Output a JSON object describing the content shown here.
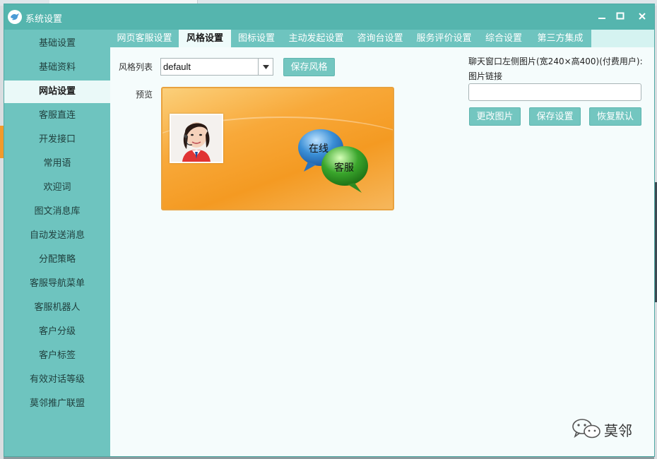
{
  "window": {
    "title": "系统设置",
    "controls": [
      "minimize-icon",
      "maximize-icon",
      "close-icon"
    ]
  },
  "sidebar": {
    "items": [
      {
        "label": "基础设置"
      },
      {
        "label": "基础资料"
      },
      {
        "label": "网站设置",
        "active": true
      },
      {
        "label": "客服直连"
      },
      {
        "label": "开发接口"
      },
      {
        "label": "常用语"
      },
      {
        "label": "欢迎词"
      },
      {
        "label": "图文消息库"
      },
      {
        "label": "自动发送消息"
      },
      {
        "label": "分配策略"
      },
      {
        "label": "客服导航菜单"
      },
      {
        "label": "客服机器人"
      },
      {
        "label": "客户分级"
      },
      {
        "label": "客户标签"
      },
      {
        "label": "有效对话等级"
      },
      {
        "label": "莫邻推广联盟"
      }
    ]
  },
  "tabs": [
    {
      "label": "网页客服设置"
    },
    {
      "label": "风格设置",
      "active": true
    },
    {
      "label": "图标设置"
    },
    {
      "label": "主动发起设置"
    },
    {
      "label": "咨询台设置"
    },
    {
      "label": "服务评价设置"
    },
    {
      "label": "综合设置"
    },
    {
      "label": "第三方集成"
    }
  ],
  "style_panel": {
    "style_list_label": "风格列表",
    "style_selected": "default",
    "save_style_label": "保存风格",
    "preview_label": "预览",
    "preview_bubble_online": "在线",
    "preview_bubble_service": "客服"
  },
  "image_panel": {
    "title": "聊天窗口左侧图片(宽240×高400)(付费用户):",
    "link_label": "图片链接",
    "link_value": "",
    "change_label": "更改图片",
    "save_label": "保存设置",
    "restore_label": "恢复默认"
  },
  "watermark": {
    "text": "莫邻"
  },
  "colors": {
    "theme": "#6ec4bf",
    "titlebar": "#55b5ae",
    "active_bg": "#eaf9f8",
    "preview_orange": "#f49a22",
    "bubble_blue": "#3b8fd6",
    "bubble_green": "#3aa62c"
  }
}
